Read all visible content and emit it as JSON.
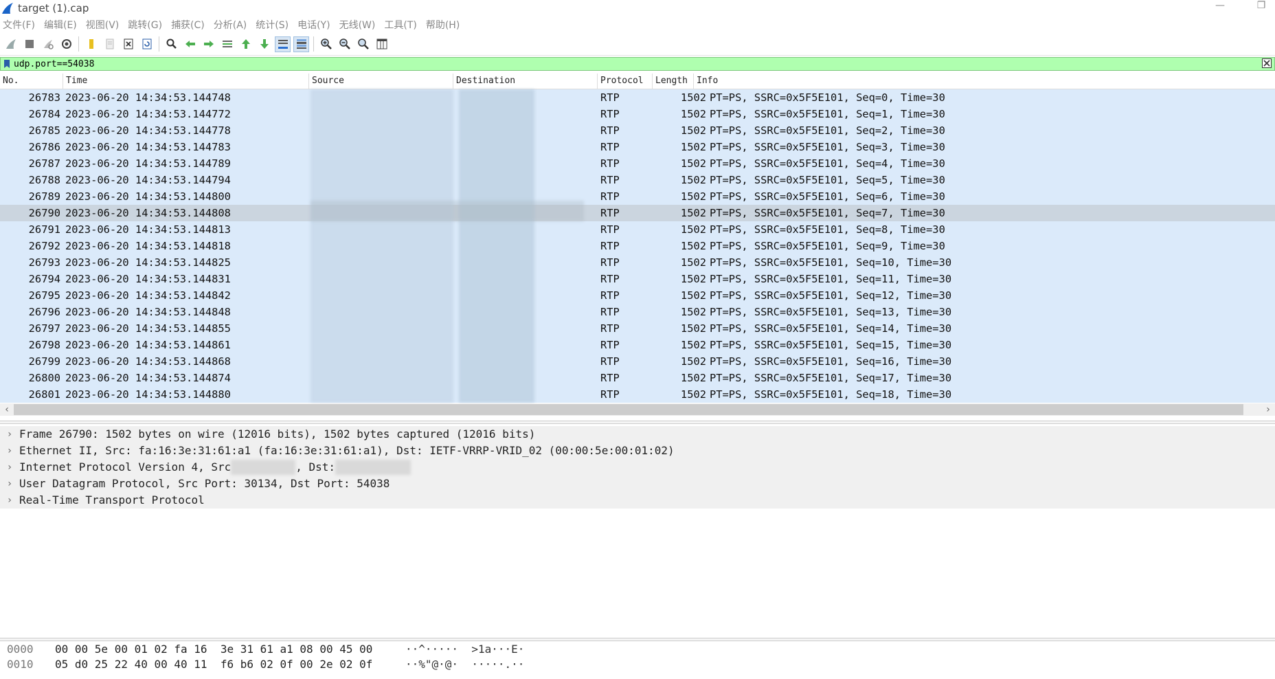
{
  "window": {
    "title": "target (1).cap",
    "minimize": "—",
    "restore": "❐"
  },
  "menu": [
    "文件(F)",
    "编辑(E)",
    "视图(V)",
    "跳转(G)",
    "捕获(C)",
    "分析(A)",
    "统计(S)",
    "电话(Y)",
    "无线(W)",
    "工具(T)",
    "帮助(H)"
  ],
  "filter": {
    "value": "udp.port==54038",
    "status_color": "#afffaf"
  },
  "packet_list": {
    "columns": [
      "No.",
      "Time",
      "Source",
      "Destination",
      "Protocol",
      "Length",
      "Info"
    ],
    "selected_no": "26790",
    "rows": [
      {
        "no": "26783",
        "time": "2023-06-20 14:34:53.144748",
        "proto": "RTP",
        "len": "1502",
        "info": "PT=PS, SSRC=0x5F5E101, Seq=0, Time=30"
      },
      {
        "no": "26784",
        "time": "2023-06-20 14:34:53.144772",
        "proto": "RTP",
        "len": "1502",
        "info": "PT=PS, SSRC=0x5F5E101, Seq=1, Time=30"
      },
      {
        "no": "26785",
        "time": "2023-06-20 14:34:53.144778",
        "proto": "RTP",
        "len": "1502",
        "info": "PT=PS, SSRC=0x5F5E101, Seq=2, Time=30"
      },
      {
        "no": "26786",
        "time": "2023-06-20 14:34:53.144783",
        "proto": "RTP",
        "len": "1502",
        "info": "PT=PS, SSRC=0x5F5E101, Seq=3, Time=30"
      },
      {
        "no": "26787",
        "time": "2023-06-20 14:34:53.144789",
        "proto": "RTP",
        "len": "1502",
        "info": "PT=PS, SSRC=0x5F5E101, Seq=4, Time=30"
      },
      {
        "no": "26788",
        "time": "2023-06-20 14:34:53.144794",
        "proto": "RTP",
        "len": "1502",
        "info": "PT=PS, SSRC=0x5F5E101, Seq=5, Time=30"
      },
      {
        "no": "26789",
        "time": "2023-06-20 14:34:53.144800",
        "proto": "RTP",
        "len": "1502",
        "info": "PT=PS, SSRC=0x5F5E101, Seq=6, Time=30"
      },
      {
        "no": "26790",
        "time": "2023-06-20 14:34:53.144808",
        "proto": "RTP",
        "len": "1502",
        "info": "PT=PS, SSRC=0x5F5E101, Seq=7, Time=30"
      },
      {
        "no": "26791",
        "time": "2023-06-20 14:34:53.144813",
        "proto": "RTP",
        "len": "1502",
        "info": "PT=PS, SSRC=0x5F5E101, Seq=8, Time=30"
      },
      {
        "no": "26792",
        "time": "2023-06-20 14:34:53.144818",
        "proto": "RTP",
        "len": "1502",
        "info": "PT=PS, SSRC=0x5F5E101, Seq=9, Time=30"
      },
      {
        "no": "26793",
        "time": "2023-06-20 14:34:53.144825",
        "proto": "RTP",
        "len": "1502",
        "info": "PT=PS, SSRC=0x5F5E101, Seq=10, Time=30"
      },
      {
        "no": "26794",
        "time": "2023-06-20 14:34:53.144831",
        "proto": "RTP",
        "len": "1502",
        "info": "PT=PS, SSRC=0x5F5E101, Seq=11, Time=30"
      },
      {
        "no": "26795",
        "time": "2023-06-20 14:34:53.144842",
        "proto": "RTP",
        "len": "1502",
        "info": "PT=PS, SSRC=0x5F5E101, Seq=12, Time=30"
      },
      {
        "no": "26796",
        "time": "2023-06-20 14:34:53.144848",
        "proto": "RTP",
        "len": "1502",
        "info": "PT=PS, SSRC=0x5F5E101, Seq=13, Time=30"
      },
      {
        "no": "26797",
        "time": "2023-06-20 14:34:53.144855",
        "proto": "RTP",
        "len": "1502",
        "info": "PT=PS, SSRC=0x5F5E101, Seq=14, Time=30"
      },
      {
        "no": "26798",
        "time": "2023-06-20 14:34:53.144861",
        "proto": "RTP",
        "len": "1502",
        "info": "PT=PS, SSRC=0x5F5E101, Seq=15, Time=30"
      },
      {
        "no": "26799",
        "time": "2023-06-20 14:34:53.144868",
        "proto": "RTP",
        "len": "1502",
        "info": "PT=PS, SSRC=0x5F5E101, Seq=16, Time=30"
      },
      {
        "no": "26800",
        "time": "2023-06-20 14:34:53.144874",
        "proto": "RTP",
        "len": "1502",
        "info": "PT=PS, SSRC=0x5F5E101, Seq=17, Time=30"
      },
      {
        "no": "26801",
        "time": "2023-06-20 14:34:53.144880",
        "proto": "RTP",
        "len": "1502",
        "info": "PT=PS, SSRC=0x5F5E101, Seq=18, Time=30"
      }
    ]
  },
  "details": {
    "frame": "Frame 26790: 1502 bytes on wire (12016 bits), 1502 bytes captured (12016 bits)",
    "ethernet": "Ethernet II, Src: fa:16:3e:31:61:a1 (fa:16:3e:31:61:a1), Dst: IETF-VRRP-VRID_02 (00:00:5e:00:01:02)",
    "ip_prefix": "Internet Protocol Version 4, Src",
    "ip_dst_label": ", Dst:",
    "udp": "User Datagram Protocol, Src Port: 30134, Dst Port: 54038",
    "rtp": "Real-Time Transport Protocol"
  },
  "bytes": [
    {
      "offset": "0000",
      "hex": "00 00 5e 00 01 02 fa 16  3e 31 61 a1 08 00 45 00",
      "ascii": "··^·····  >1a···E·"
    },
    {
      "offset": "0010",
      "hex": "05 d0 25 22 40 00 40 11  f6 b6 02 0f 00 2e 02 0f",
      "ascii": "··%\"@·@·  ·····.··"
    }
  ],
  "colors": {
    "row_bg": "#dbeafa",
    "selected_row_bg": "#cbd5df",
    "filter_ok": "#afffaf"
  }
}
